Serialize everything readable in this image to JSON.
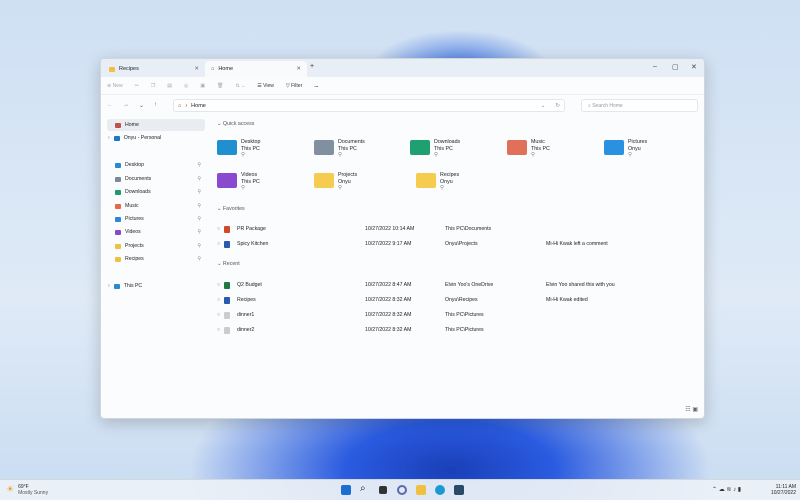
{
  "tabs": [
    {
      "label": "Recipes",
      "active": false
    },
    {
      "label": "Home",
      "active": true
    }
  ],
  "toolbar": {
    "new": "New",
    "view": "View",
    "filter": "Filter",
    "more": "..."
  },
  "address": {
    "path": "Home",
    "search_placeholder": "Search Home"
  },
  "sidebar": {
    "items": [
      {
        "label": "Home",
        "selected": true,
        "color": "#c0504d"
      },
      {
        "label": "Onyu - Personal",
        "color": "#1e78c8"
      },
      {
        "label": "Desktop",
        "pinned": true,
        "color": "#2a8ad0"
      },
      {
        "label": "Documents",
        "pinned": true,
        "color": "#7a8a9a"
      },
      {
        "label": "Downloads",
        "pinned": true,
        "color": "#1f9a6e"
      },
      {
        "label": "Music",
        "pinned": true,
        "color": "#e06a4a"
      },
      {
        "label": "Pictures",
        "pinned": true,
        "color": "#2a8ad0"
      },
      {
        "label": "Videos",
        "pinned": true,
        "color": "#8a4ac8"
      },
      {
        "label": "Projects",
        "pinned": true,
        "color": "#f0c040"
      },
      {
        "label": "Recipes",
        "pinned": true,
        "color": "#f0c040"
      },
      {
        "label": "This PC",
        "color": "#2a8ad0"
      }
    ]
  },
  "quick_access": {
    "title": "Quick access",
    "items": [
      {
        "name": "Desktop",
        "location": "This PC",
        "color": "#1f8fd0"
      },
      {
        "name": "Documents",
        "location": "This PC",
        "color": "#8090a0"
      },
      {
        "name": "Downloads",
        "location": "This PC",
        "color": "#1fa070"
      },
      {
        "name": "Music",
        "location": "This PC",
        "color": "#e0705a"
      },
      {
        "name": "Pictures",
        "location": "Onyu",
        "color": "#2a90e0"
      },
      {
        "name": "Videos",
        "location": "This PC",
        "color": "#8a4ad0"
      },
      {
        "name": "Projects",
        "location": "Onyu",
        "color": "#f5cc50"
      },
      {
        "name": "Recipes",
        "location": "Onyu",
        "color": "#f5cc50"
      }
    ]
  },
  "favorites": {
    "title": "Favorites",
    "rows": [
      {
        "name": "PR Package",
        "date": "10/27/2022 10:14 AM",
        "location": "This PC\\Documents",
        "activity": "",
        "color": "#d04a2a"
      },
      {
        "name": "Spicy Kitchen",
        "date": "10/27/2022 9:17 AM",
        "location": "Onyu\\Projects",
        "activity": "Mi-Hi Kwak left a comment",
        "color": "#2a5ab0"
      }
    ]
  },
  "recent": {
    "title": "Recent",
    "rows": [
      {
        "name": "Q2 Budget",
        "date": "10/27/2022 8:47 AM",
        "location": "Elvin Yoo's OneDrive",
        "activity": "Elvin Yoo shared this with you",
        "color": "#1e7a45"
      },
      {
        "name": "Recipes",
        "date": "10/27/2022 8:32 AM",
        "location": "Onyu\\Recipes",
        "activity": "Mi-Hi Kwak edited",
        "color": "#2a5ab0"
      },
      {
        "name": "dinner1",
        "date": "10/27/2022 8:32 AM",
        "location": "This PC\\Pictures",
        "activity": "",
        "color": "#ccc"
      },
      {
        "name": "dinner2",
        "date": "10/27/2022 8:32 AM",
        "location": "This PC\\Pictures",
        "activity": "",
        "color": "#ccc"
      }
    ]
  },
  "taskbar": {
    "weather_temp": "69°F",
    "weather_desc": "Mostly Sunny",
    "time": "11:11 AM",
    "date": "10/27/2022"
  }
}
